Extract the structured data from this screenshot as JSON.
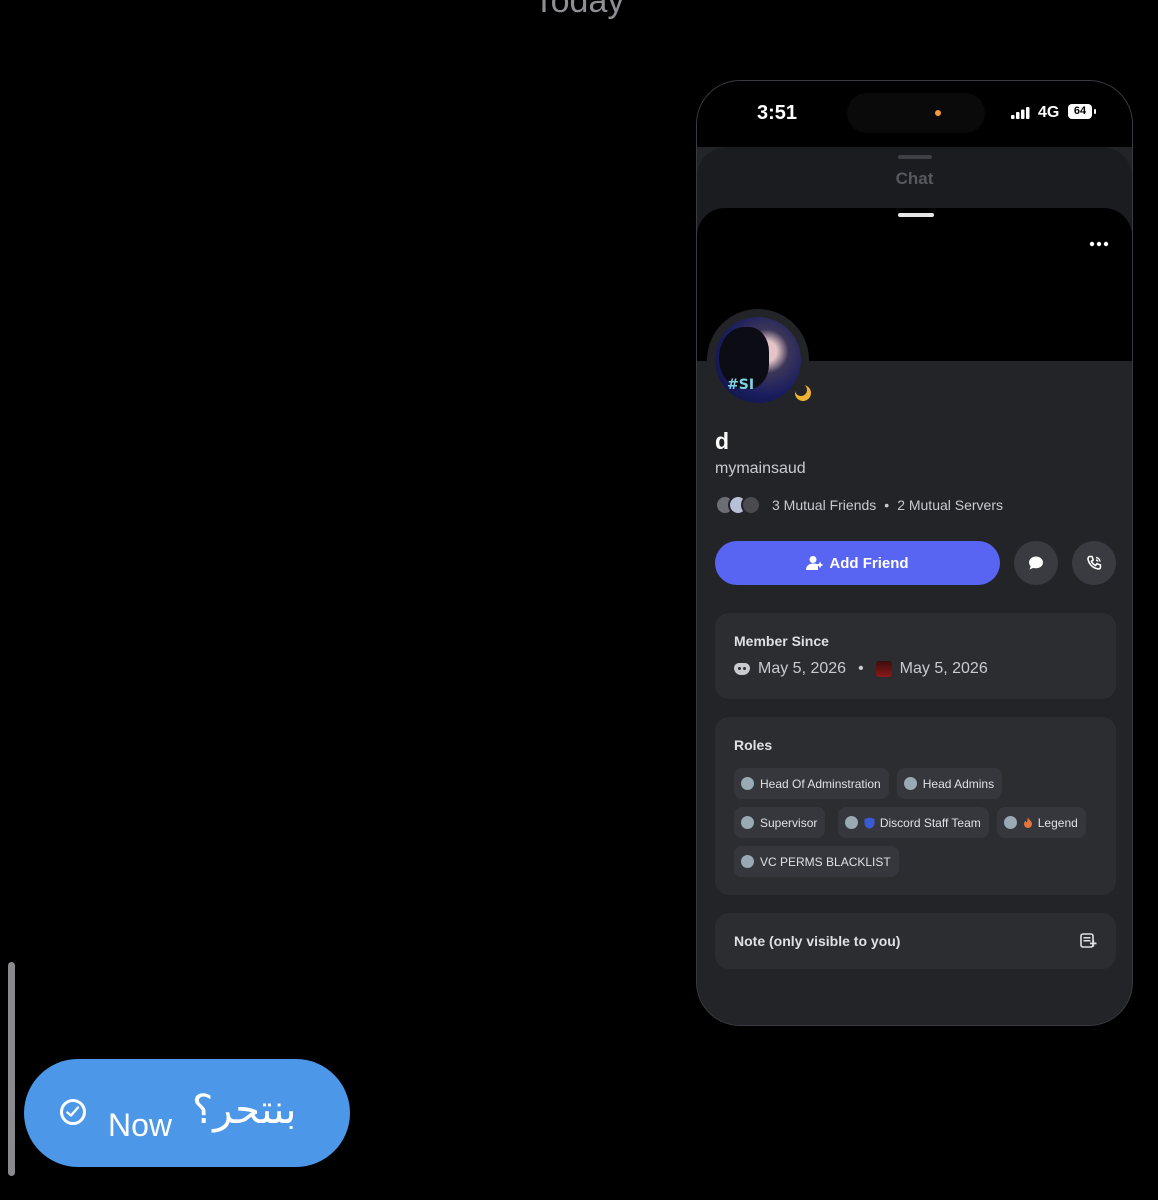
{
  "header": {
    "date_divider": "Today"
  },
  "message": {
    "text": "بنتحر؟",
    "time": "Now",
    "status_icon": "check-circle-icon"
  },
  "phone": {
    "status_bar": {
      "time": "3:51",
      "network": "4G",
      "battery": "64"
    },
    "chat_label": "Chat",
    "profile": {
      "display_name": "d",
      "username": "mymainsaud",
      "avatar_tag": "#SI",
      "mutual_friends": "3 Mutual Friends",
      "mutual_servers": "2 Mutual Servers",
      "separator": "•",
      "add_friend_label": "Add Friend",
      "member_since": {
        "title": "Member Since",
        "discord_date": "May 5, 2026",
        "server_date": "May 5, 2026"
      },
      "roles": {
        "title": "Roles",
        "items": [
          {
            "label": "Head Of Adminstration",
            "emoji": ""
          },
          {
            "label": "Head Admins",
            "emoji": ""
          },
          {
            "label": "Supervisor",
            "emoji": ""
          },
          {
            "label": "Discord Staff Team",
            "emoji": "shield"
          },
          {
            "label": "Legend",
            "emoji": "fire"
          },
          {
            "label": "VC PERMS BLACKLIST",
            "emoji": ""
          }
        ]
      },
      "note_label": "Note (only visible to you)"
    }
  },
  "colors": {
    "accent": "#5865f2",
    "bubble": "#4c97e8",
    "idle_status": "#f0b232"
  }
}
